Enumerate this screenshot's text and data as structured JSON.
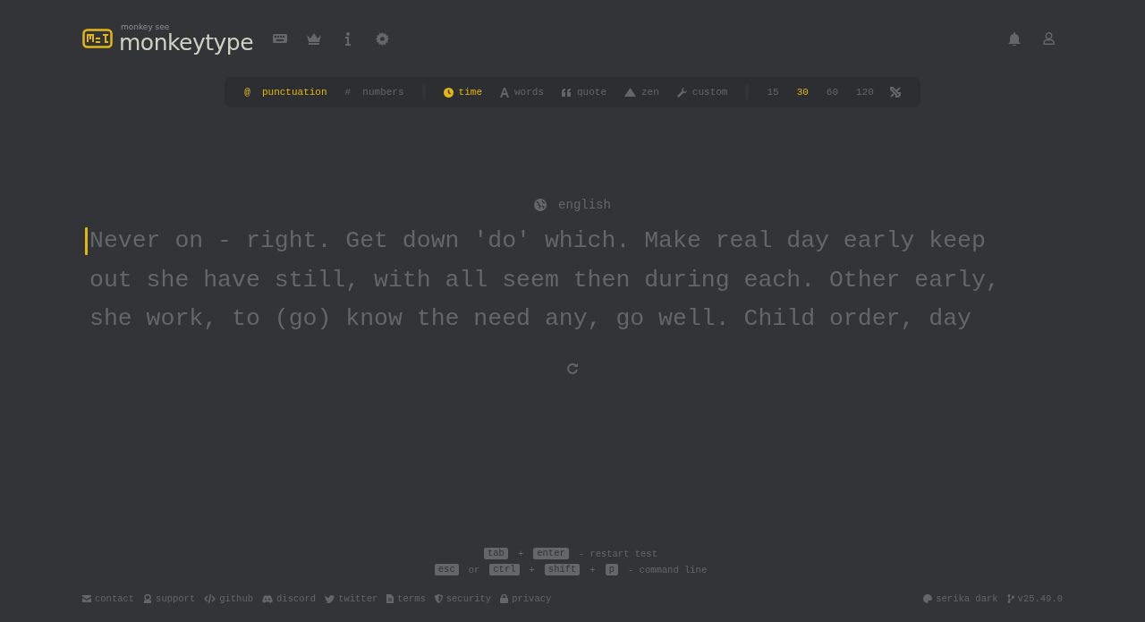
{
  "header": {
    "logo_caption": "monkey see",
    "logo_text": "monkeytype",
    "nav": [
      {
        "kind": "keyboard"
      },
      {
        "kind": "crown"
      },
      {
        "kind": "info"
      },
      {
        "kind": "gear"
      }
    ],
    "account": [
      {
        "kind": "bell"
      },
      {
        "kind": "user"
      }
    ]
  },
  "config": {
    "toggles": [
      {
        "icon": "@",
        "label": "punctuation",
        "selected": true
      },
      {
        "icon": "#",
        "label": "numbers",
        "selected": false
      }
    ],
    "modes": [
      {
        "kind": "clock",
        "label": "time",
        "selected": true
      },
      {
        "kind": "letter",
        "label": "words",
        "selected": false
      },
      {
        "kind": "quote",
        "label": "quote",
        "selected": false
      },
      {
        "kind": "mountain",
        "label": "zen",
        "selected": false
      },
      {
        "kind": "wrench",
        "label": "custom",
        "selected": false
      }
    ],
    "durations": [
      {
        "label": "15",
        "selected": false
      },
      {
        "label": "30",
        "selected": true
      },
      {
        "label": "60",
        "selected": false
      },
      {
        "label": "120",
        "selected": false
      }
    ]
  },
  "language": "english",
  "test_lines": [
    "Never on - right. Get down 'do' which. Make real day early keep",
    "out she have still, with all seem then during each. Other early,",
    "she work, to (go) know the need any, go well. Child order, day"
  ],
  "hints": [
    {
      "parts": [
        {
          "kind": "key",
          "text": "tab"
        },
        {
          "kind": "sep",
          "text": "+"
        },
        {
          "kind": "key",
          "text": "enter"
        },
        {
          "kind": "sep",
          "text": "- restart test"
        }
      ]
    },
    {
      "parts": [
        {
          "kind": "key",
          "text": "esc"
        },
        {
          "kind": "sep",
          "text": "or"
        },
        {
          "kind": "key",
          "text": "ctrl"
        },
        {
          "kind": "sep",
          "text": "+"
        },
        {
          "kind": "key",
          "text": "shift"
        },
        {
          "kind": "sep",
          "text": "+"
        },
        {
          "kind": "key",
          "text": "p"
        },
        {
          "kind": "sep",
          "text": "- command line"
        }
      ]
    }
  ],
  "footer_links": [
    {
      "kind": "mail",
      "label": "contact"
    },
    {
      "kind": "support",
      "label": "support"
    },
    {
      "kind": "code",
      "label": "github"
    },
    {
      "kind": "chat",
      "label": "discord"
    },
    {
      "kind": "bird",
      "label": "twitter"
    },
    {
      "kind": "doc",
      "label": "terms"
    },
    {
      "kind": "shield",
      "label": "security"
    },
    {
      "kind": "lock",
      "label": "privacy"
    }
  ],
  "theme": "serika dark",
  "version": "v25.49.0"
}
